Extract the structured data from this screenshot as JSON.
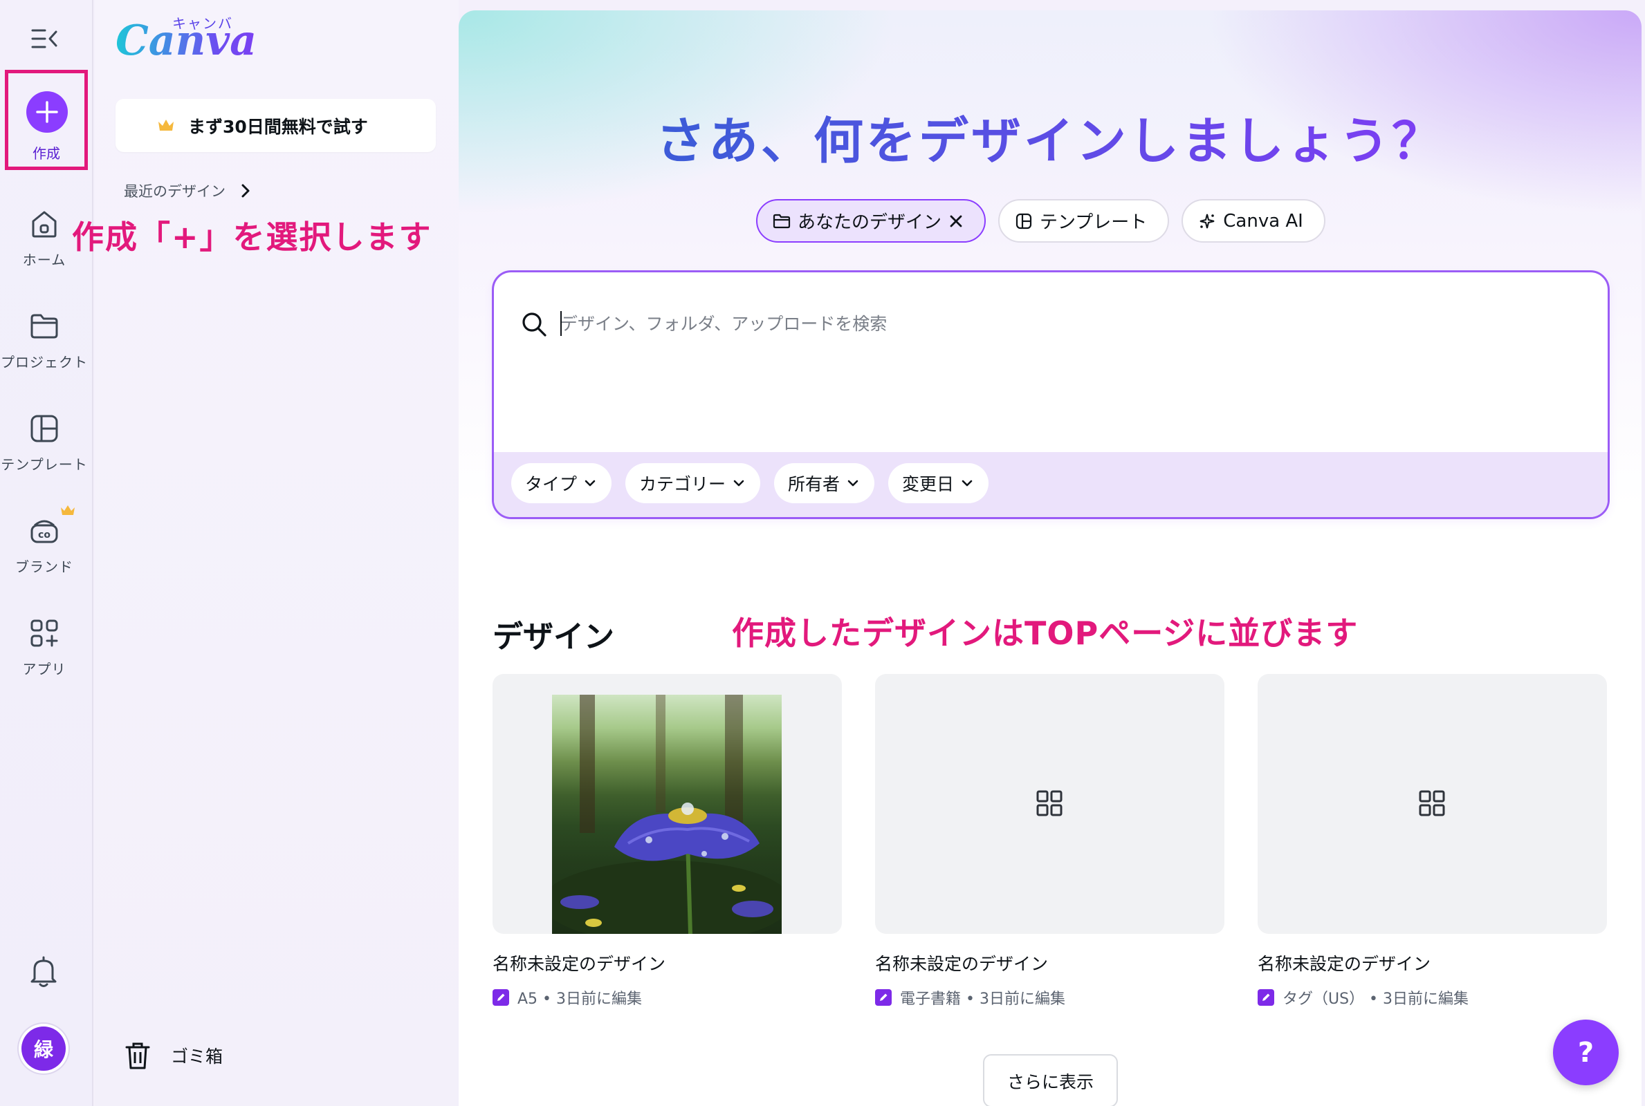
{
  "rail": {
    "create_label": "作成",
    "items": [
      {
        "label": "ホーム",
        "icon": "home-icon"
      },
      {
        "label": "プロジェクト",
        "icon": "folder-icon"
      },
      {
        "label": "テンプレート",
        "icon": "template-icon"
      },
      {
        "label": "ブランド",
        "icon": "brand-icon"
      },
      {
        "label": "アプリ",
        "icon": "apps-icon"
      }
    ],
    "avatar_initial": "緑"
  },
  "side": {
    "logo_text": "Canva",
    "logo_kana": "キャンバ",
    "trial_button": "まず30日間無料で試す",
    "recent_label": "最近のデザイン",
    "trash_label": "ゴミ箱"
  },
  "annotations": {
    "create": "作成「+」を選択します",
    "designs": "作成したデザインはTOPページに並びます"
  },
  "main": {
    "headline": "さあ、何をデザインしましょう？",
    "chips": [
      {
        "label": "あなたのデザイン",
        "icon": "folder-icon",
        "active": true
      },
      {
        "label": "テンプレート",
        "icon": "template-icon",
        "active": false
      },
      {
        "label": "Canva AI",
        "icon": "sparkle-icon",
        "active": false
      }
    ],
    "search_placeholder": "デザイン、フォルダ、アップロードを検索",
    "filters": [
      "タイプ",
      "カテゴリー",
      "所有者",
      "変更日"
    ],
    "section_title": "デザイン",
    "designs": [
      {
        "title": "名称未設定のデザイン",
        "meta": "A5 • 3日前に編集",
        "thumb": "photo"
      },
      {
        "title": "名称未設定のデザイン",
        "meta": "電子書籍 • 3日前に編集",
        "thumb": "placeholder"
      },
      {
        "title": "名称未設定のデザイン",
        "meta": "タグ（US） • 3日前に編集",
        "thumb": "placeholder"
      }
    ],
    "more_button": "さらに表示",
    "help_button": "?"
  },
  "colors": {
    "brand_purple": "#8b3dff",
    "annotation_pink": "#e2197c"
  }
}
